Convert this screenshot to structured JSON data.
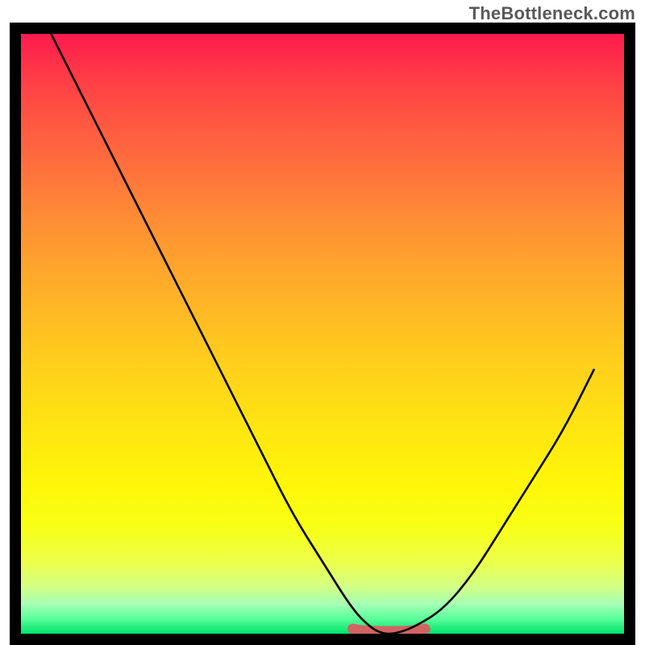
{
  "watermark": "TheBottleneck.com",
  "colors": {
    "frame": "#000000",
    "curve": "#000000",
    "optimal_band": "#d16464",
    "gradient_top": "#ff1a4e",
    "gradient_mid": "#ffe412",
    "gradient_bottom": "#00e26a"
  },
  "chart_data": {
    "type": "line",
    "title": "",
    "xlabel": "",
    "ylabel": "",
    "xlim": [
      0,
      100
    ],
    "ylim": [
      0,
      100
    ],
    "grid": false,
    "series": [
      {
        "name": "bottleneck_curve",
        "x": [
          5,
          10,
          15,
          20,
          25,
          30,
          35,
          40,
          45,
          50,
          55,
          58,
          60,
          62,
          65,
          70,
          75,
          80,
          85,
          90,
          95
        ],
        "values": [
          100,
          90,
          80,
          70,
          60,
          50,
          40,
          30,
          20,
          12,
          4,
          1,
          0,
          0,
          1,
          4,
          10,
          18,
          26,
          34,
          44
        ]
      }
    ],
    "annotations": [
      {
        "name": "optimal_range",
        "x_start": 55,
        "x_end": 67,
        "y": 0
      }
    ]
  }
}
